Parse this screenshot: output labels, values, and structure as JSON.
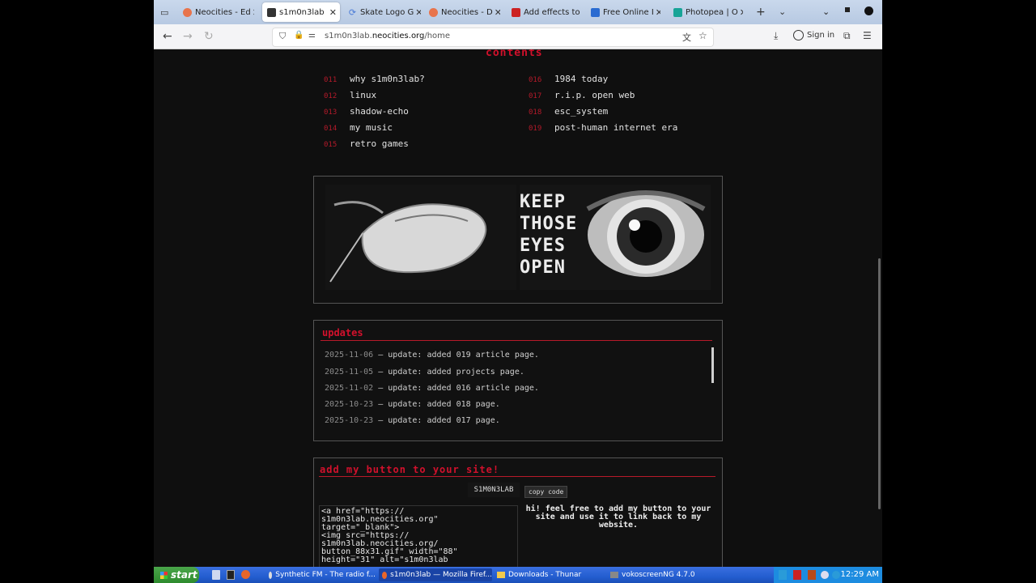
{
  "browser": {
    "tabs": [
      {
        "label": "Neocities - Ed",
        "icon": "neocities-icon",
        "color": "#e8744c"
      },
      {
        "label": "s1m0n3lab",
        "icon": "site-icon",
        "color": "#333333",
        "active": true
      },
      {
        "label": "Skate Logo G",
        "icon": "link-icon",
        "color": "#4a7bd6"
      },
      {
        "label": "Neocities - D",
        "icon": "neocities-icon",
        "color": "#e8744c"
      },
      {
        "label": "Add effects to",
        "icon": "image-icon",
        "color": "#cc2222"
      },
      {
        "label": "Free Online I",
        "icon": "photo-icon",
        "color": "#2a6bd1"
      },
      {
        "label": "Photopea | O",
        "icon": "photopea-icon",
        "color": "#18a497"
      }
    ],
    "url_prefix": "s1m0n3lab.",
    "url_domain": "neocities.org",
    "url_path": "/home",
    "sign_in": "Sign in"
  },
  "page": {
    "contents_title": "contents",
    "toc_left": [
      {
        "num": "011",
        "label": "why s1m0n3lab?"
      },
      {
        "num": "012",
        "label": "linux"
      },
      {
        "num": "013",
        "label": "shadow-echo"
      },
      {
        "num": "014",
        "label": "my music"
      },
      {
        "num": "015",
        "label": "retro games"
      }
    ],
    "toc_right": [
      {
        "num": "016",
        "label": "1984 today"
      },
      {
        "num": "017",
        "label": "r.i.p. open web"
      },
      {
        "num": "018",
        "label": "esc_system"
      },
      {
        "num": "019",
        "label": "post-human internet era"
      }
    ],
    "banner_text": "KEEP THOSE EYES OPEN",
    "updates_title": "updates",
    "updates": [
      {
        "date": "2025-11-06",
        "text": "— update: added 019 article page."
      },
      {
        "date": "2025-11-05",
        "text": "— update: added projects page."
      },
      {
        "date": "2025-11-02",
        "text": "— update: added 016 article page."
      },
      {
        "date": "2025-10-23",
        "text": "— update: added 018 page."
      },
      {
        "date": "2025-10-23",
        "text": "— update: added 017 page."
      }
    ],
    "button_title": "add my button to your site!",
    "button_logo": "S1M0N3LAB",
    "copy_code": "copy code",
    "code_lines": "<a href=\"https://\ns1m0n3lab.neocities.org\"\ntarget=\"_blank\">\n<img src=\"https://\ns1m0n3lab.neocities.org/\nbutton_88x31.gif\" width=\"88\"\nheight=\"31\" alt=\"s1m0n3lab",
    "button_desc": "hi! feel free to add my button to your site and use it to link back to my website."
  },
  "taskbar": {
    "start": "start",
    "tasks": [
      {
        "label": "Synthetic FM - The radio f..."
      },
      {
        "label": "s1m0n3lab — Mozilla Firef..."
      },
      {
        "label": "Downloads - Thunar"
      },
      {
        "label": "vokoscreenNG 4.7.0"
      }
    ],
    "clock": "12:29 AM"
  },
  "colors": {
    "accent_red": "#d2112c",
    "page_bg": "#0f0f0f",
    "taskbar_blue": "#245ed0"
  }
}
